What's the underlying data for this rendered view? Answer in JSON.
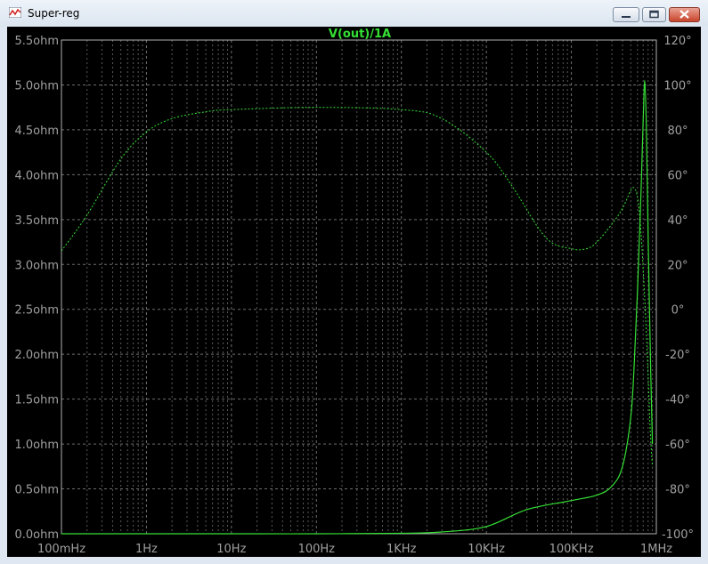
{
  "window": {
    "title": "Super-reg"
  },
  "window_controls": {
    "minimize": "minimize",
    "maximize": "maximize",
    "close": "close"
  },
  "chart_data": {
    "type": "line",
    "title": "V(out)/1A",
    "x_scale": "log",
    "x_ticks": [
      "100mHz",
      "1Hz",
      "10Hz",
      "100Hz",
      "1KHz",
      "10KHz",
      "100KHz",
      "1MHz"
    ],
    "x_tick_values": [
      0.1,
      1,
      10,
      100,
      1000,
      10000,
      100000,
      1000000
    ],
    "xlim": [
      0.1,
      1000000
    ],
    "y_left_ticks": [
      "0.0ohm",
      "0.5ohm",
      "1.0ohm",
      "1.5ohm",
      "2.0ohm",
      "2.5ohm",
      "3.0ohm",
      "3.5ohm",
      "4.0ohm",
      "4.5ohm",
      "5.0ohm",
      "5.5ohm"
    ],
    "ylim_left": [
      0,
      5.5
    ],
    "y_right_ticks": [
      "-100°",
      "-80°",
      "-60°",
      "-40°",
      "-20°",
      "0°",
      "20°",
      "40°",
      "60°",
      "80°",
      "100°",
      "120°"
    ],
    "ylim_right": [
      -100,
      120
    ],
    "grid": true,
    "colors": {
      "background": "#000000",
      "trace": "#35e035",
      "axis_text": "#a0a0a0",
      "grid": "#7a7a7a"
    },
    "series": [
      {
        "name": "V(out)/1A",
        "quantity": "magnitude",
        "axis": "left",
        "style": "solid",
        "x": [
          0.1,
          1,
          10,
          100,
          1000,
          3000,
          10000,
          30000,
          100000,
          200000,
          300000,
          400000,
          500000,
          550000,
          600000,
          650000,
          700000,
          730000,
          760000,
          780000,
          800000,
          830000,
          860000,
          900000
        ],
        "y": [
          0.0,
          0.0,
          0.0,
          0.0,
          0.005,
          0.02,
          0.08,
          0.27,
          0.37,
          0.43,
          0.53,
          0.75,
          1.3,
          1.9,
          2.7,
          3.6,
          4.6,
          5.05,
          4.6,
          4.0,
          3.3,
          2.5,
          1.8,
          1.0
        ]
      },
      {
        "name": "V(out)/1A",
        "quantity": "phase",
        "axis": "right",
        "style": "dashed",
        "x": [
          0.1,
          0.2,
          0.5,
          1,
          2,
          5,
          10,
          100,
          1000,
          3000,
          10000,
          20000,
          50000,
          100000,
          150000,
          200000,
          300000,
          400000,
          500000,
          550000,
          600000,
          650000,
          700000,
          750000,
          800000,
          850000,
          900000
        ],
        "y": [
          26,
          42,
          67,
          79,
          85,
          88,
          89,
          90,
          89,
          85,
          70,
          55,
          32,
          27,
          27,
          30,
          38,
          45,
          53,
          54,
          50,
          38,
          18,
          -5,
          -30,
          -55,
          -70
        ]
      }
    ]
  }
}
